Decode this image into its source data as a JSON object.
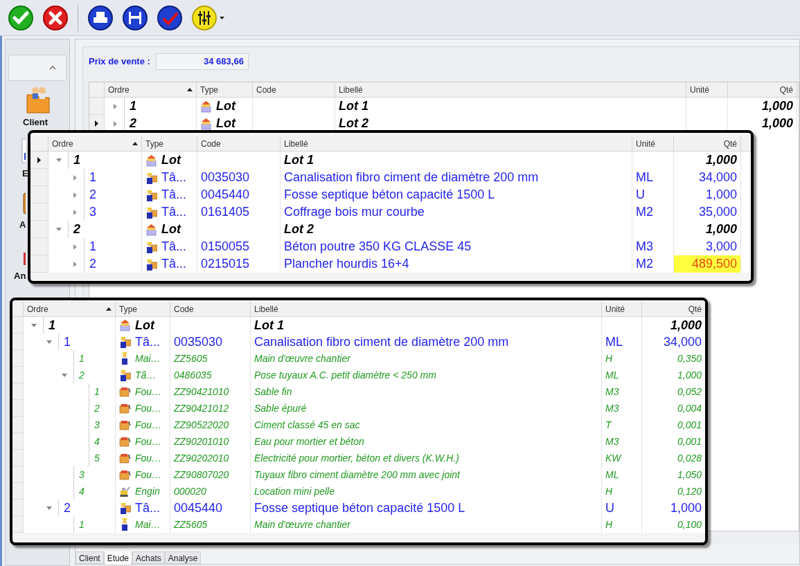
{
  "toolbar": {
    "buttons": [
      {
        "kind": "ok"
      },
      {
        "kind": "cancel"
      },
      {
        "kind": "print"
      },
      {
        "kind": "save"
      },
      {
        "kind": "spellcheck"
      },
      {
        "kind": "settings",
        "dropdown": true
      }
    ]
  },
  "sidebar": {
    "items": [
      {
        "kind": "client",
        "label": "Client"
      },
      {
        "kind": "study",
        "label": "E"
      },
      {
        "kind": "purchases",
        "label": "A"
      },
      {
        "kind": "analysis",
        "label": "An"
      }
    ]
  },
  "price": {
    "label": "Prix de vente :",
    "value": "34 683,66"
  },
  "grid": {
    "columns": [
      "Ordre",
      "Type",
      "Code",
      "Libellé",
      "Unité",
      "Qté"
    ],
    "rows": [
      {
        "ordre": "1",
        "kind": "lot",
        "type": "Lot",
        "libelle": "Lot 1",
        "qte": "1,000",
        "expanded": false,
        "current": false
      },
      {
        "ordre": "2",
        "kind": "lot",
        "type": "Lot",
        "libelle": "Lot 2",
        "qte": "1,000",
        "expanded": false,
        "current": true
      }
    ]
  },
  "callout_grids": [
    {
      "columns": [
        "Ordre",
        "Type",
        "Code",
        "Libellé",
        "Unité",
        "Qté"
      ],
      "rows": [
        {
          "ordre": "1",
          "kind": "lot",
          "type": "Lot",
          "libelle": "Lot 1",
          "qte": "1,000",
          "expanded": true,
          "current": true,
          "children": [
            {
              "ordre": "1",
              "kind": "task",
              "type": "Tâ...",
              "code": "0035030",
              "libelle": "Canalisation fibro ciment de diamètre 200 mm",
              "unite": "ML",
              "qte": "34,000",
              "expanded": false,
              "current": false,
              "warning": false
            },
            {
              "ordre": "2",
              "kind": "task",
              "type": "Tâ...",
              "code": "0045440",
              "libelle": "Fosse septique béton capacité 1500 L",
              "unite": "U",
              "qte": "1,000",
              "expanded": false,
              "current": false,
              "warning": false
            },
            {
              "ordre": "3",
              "kind": "task",
              "type": "Tâ...",
              "code": "0161405",
              "libelle": "Coffrage bois mur courbe",
              "unite": "M2",
              "qte": "35,000",
              "expanded": false,
              "current": false,
              "warning": false
            }
          ]
        },
        {
          "ordre": "2",
          "kind": "lot",
          "type": "Lot",
          "libelle": "Lot 2",
          "qte": "1,000",
          "expanded": true,
          "current": false,
          "children": [
            {
              "ordre": "1",
              "kind": "task",
              "type": "Tâ...",
              "code": "0150055",
              "libelle": "Béton poutre 350 KG CLASSE 45",
              "unite": "M3",
              "qte": "3,000",
              "expanded": false,
              "current": false,
              "warning": false
            },
            {
              "ordre": "2",
              "kind": "task",
              "type": "Tâ...",
              "code": "0215015",
              "libelle": "Plancher hourdis 16+4",
              "unite": "M2",
              "qte": "489,500",
              "expanded": false,
              "current": false,
              "warning": true
            }
          ]
        }
      ]
    },
    {
      "columns": [
        "Ordre",
        "Type",
        "Code",
        "Libellé",
        "Unité",
        "Qté"
      ],
      "rows": [
        {
          "ordre": "1",
          "kind": "lot",
          "type": "Lot",
          "libelle": "Lot 1",
          "qte": "1,000",
          "expanded": true,
          "children": [
            {
              "ordre": "1",
              "kind": "task",
              "type": "Tâ...",
              "code": "0035030",
              "libelle": "Canalisation fibro ciment de diamètre 200 mm",
              "unite": "ML",
              "qte": "34,000",
              "expanded": true,
              "children": [
                {
                  "ordre": "1",
                  "kind": "labour",
                  "type": "Mai…",
                  "code": "ZZ5605",
                  "libelle": "Main d'œuvre chantier",
                  "unite": "H",
                  "qte": "0,350"
                },
                {
                  "ordre": "2",
                  "kind": "task",
                  "type": "Tâ…",
                  "code": "0486035",
                  "libelle": "Pose tuyaux A.C. petit diamètre < 250 mm",
                  "unite": "ML",
                  "qte": "1,000",
                  "expanded": true,
                  "children": [
                    {
                      "ordre": "1",
                      "kind": "supply",
                      "type": "Fou…",
                      "code": "ZZ90421010",
                      "libelle": "Sable fin",
                      "unite": "M3",
                      "qte": "0,052"
                    },
                    {
                      "ordre": "2",
                      "kind": "supply",
                      "type": "Fou…",
                      "code": "ZZ90421012",
                      "libelle": "Sable épuré",
                      "unite": "M3",
                      "qte": "0,004"
                    },
                    {
                      "ordre": "3",
                      "kind": "supply",
                      "type": "Fou…",
                      "code": "ZZ90522020",
                      "libelle": "Ciment classé 45 en sac",
                      "unite": "T",
                      "qte": "0,001"
                    },
                    {
                      "ordre": "4",
                      "kind": "supply",
                      "type": "Fou…",
                      "code": "ZZ90201010",
                      "libelle": "Eau pour mortier et béton",
                      "unite": "M3",
                      "qte": "0,001"
                    },
                    {
                      "ordre": "5",
                      "kind": "supply",
                      "type": "Fou…",
                      "code": "ZZ90202010",
                      "libelle": "Electricité pour mortier, béton et divers (K.W.H.)",
                      "unite": "KW",
                      "qte": "0,028"
                    }
                  ]
                },
                {
                  "ordre": "3",
                  "kind": "supply",
                  "type": "Fou…",
                  "code": "ZZ90807020",
                  "libelle": "Tuyaux fibro ciment diamètre 200 mm avec joint",
                  "unite": "ML",
                  "qte": "1,050"
                },
                {
                  "ordre": "4",
                  "kind": "machine",
                  "type": "Engin",
                  "code": "000020",
                  "libelle": "Location mini pelle",
                  "unite": "H",
                  "qte": "0,120"
                }
              ]
            },
            {
              "ordre": "2",
              "kind": "task",
              "type": "Tâ...",
              "code": "0045440",
              "libelle": "Fosse septique béton capacité 1500 L",
              "unite": "U",
              "qte": "1,000",
              "expanded": true,
              "children": [
                {
                  "ordre": "1",
                  "kind": "labour",
                  "type": "Mai…",
                  "code": "ZZ5605",
                  "libelle": "Main d'œuvre chantier",
                  "unite": "H",
                  "qte": "0,100"
                }
              ]
            }
          ]
        }
      ]
    }
  ],
  "tabs": [
    {
      "label": "Client",
      "selected": false
    },
    {
      "label": "Etude",
      "selected": true
    },
    {
      "label": "Achats",
      "selected": false
    },
    {
      "label": "Analyse",
      "selected": false
    }
  ]
}
